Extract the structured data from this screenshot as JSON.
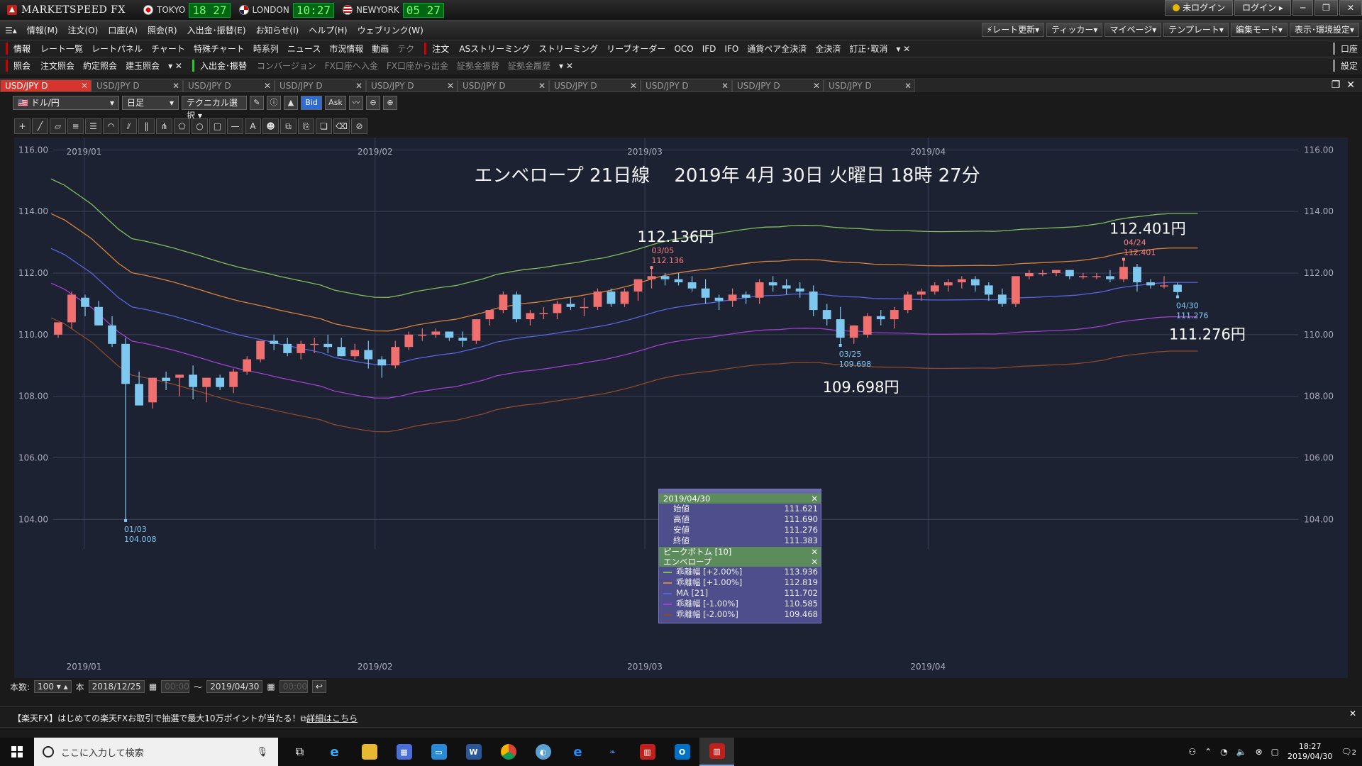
{
  "app": {
    "logo_text": "MARKETSPEED FX",
    "clocks": [
      {
        "city": "TOKYO",
        "time": "18 27"
      },
      {
        "city": "LONDON",
        "time": "10:27"
      },
      {
        "city": "NEWYORK",
        "time": "05 27"
      }
    ],
    "not_logged_in": "未ログイン",
    "login": "ログイン"
  },
  "menu": {
    "items": [
      "情報(M)",
      "注文(O)",
      "口座(A)",
      "照会(R)",
      "入出金･振替(E)",
      "お知らせ(I)",
      "ヘルプ(H)",
      "ウェブリンク(W)"
    ],
    "right": [
      "レート更新",
      "ティッカー",
      "マイページ",
      "テンプレート",
      "編集モード",
      "表示･環境設定"
    ]
  },
  "toolbar1": {
    "head1": "情報",
    "items1": [
      "レート一覧",
      "レートパネル",
      "チャート",
      "特殊チャート",
      "時系列",
      "ニュース",
      "市況情報",
      "動画",
      "テク"
    ],
    "head2": "注文",
    "items2": [
      "ASストリーミング",
      "ストリーミング",
      "リーブオーダー",
      "OCO",
      "IFD",
      "IFO",
      "通貨ペア全決済",
      "全決済",
      "訂正･取消"
    ],
    "right": "口座"
  },
  "toolbar2": {
    "head1": "照会",
    "items1": [
      "注文照会",
      "約定照会",
      "建玉照会"
    ],
    "head2": "入出金･振替",
    "items2": [
      "コンバージョン",
      "FX口座へ入金",
      "FX口座から出金",
      "証拠金振替",
      "証拠金履歴"
    ],
    "right": "設定"
  },
  "tabs": [
    "USD/JPY D",
    "USD/JPY D",
    "USD/JPY D",
    "USD/JPY D",
    "USD/JPY D",
    "USD/JPY D",
    "USD/JPY D",
    "USD/JPY D",
    "USD/JPY D",
    "USD/JPY D"
  ],
  "chart_controls": {
    "pair": "ドル/円",
    "period": "日足",
    "technical": "テクニカル選択",
    "bid": "Bid",
    "ask": "Ask"
  },
  "chart_data": {
    "type": "candlestick",
    "title": "エンベロープ 21日線　 2019年 4月 30日 火曜日 18時 27分",
    "ylim": [
      103.5,
      116.4
    ],
    "yticks": [
      "116.00",
      "114.00",
      "112.00",
      "110.00",
      "108.00",
      "106.00",
      "104.00"
    ],
    "month_labels": [
      {
        "label": "2019/01",
        "index": 2
      },
      {
        "label": "2019/02",
        "index": 24
      },
      {
        "label": "2019/03",
        "index": 44
      },
      {
        "label": "2019/04",
        "index": 65
      }
    ],
    "candles": [
      [
        110.0,
        110.4,
        109.9,
        110.4
      ],
      [
        110.4,
        111.4,
        110.2,
        111.3
      ],
      [
        111.2,
        111.3,
        110.6,
        110.9
      ],
      [
        110.9,
        111.1,
        110.3,
        110.3
      ],
      [
        110.3,
        110.6,
        109.6,
        109.7
      ],
      [
        109.7,
        109.9,
        104.008,
        108.4
      ],
      [
        108.4,
        108.8,
        107.8,
        107.7
      ],
      [
        107.8,
        108.6,
        107.6,
        108.6
      ],
      [
        108.6,
        108.8,
        108.2,
        108.5
      ],
      [
        108.6,
        108.7,
        108.0,
        108.7
      ],
      [
        108.7,
        109.0,
        107.9,
        108.3
      ],
      [
        108.3,
        108.6,
        107.8,
        108.6
      ],
      [
        108.6,
        108.7,
        108.2,
        108.3
      ],
      [
        108.3,
        108.9,
        108.1,
        108.8
      ],
      [
        108.8,
        109.3,
        108.7,
        109.2
      ],
      [
        109.2,
        109.8,
        109.1,
        109.8
      ],
      [
        109.8,
        110.0,
        109.5,
        109.7
      ],
      [
        109.7,
        109.9,
        109.3,
        109.4
      ],
      [
        109.4,
        109.8,
        109.2,
        109.7
      ],
      [
        109.7,
        109.9,
        109.4,
        109.7
      ],
      [
        109.7,
        110.0,
        109.4,
        109.6
      ],
      [
        109.6,
        109.9,
        109.3,
        109.3
      ],
      [
        109.3,
        109.7,
        109.2,
        109.5
      ],
      [
        109.5,
        109.8,
        108.9,
        109.2
      ],
      [
        109.2,
        109.3,
        108.6,
        109.0
      ],
      [
        109.0,
        109.8,
        108.9,
        109.6
      ],
      [
        109.6,
        110.1,
        109.5,
        110.0
      ],
      [
        110.0,
        110.2,
        109.8,
        110.0
      ],
      [
        110.0,
        110.2,
        109.9,
        110.1
      ],
      [
        110.1,
        110.1,
        109.8,
        109.9
      ],
      [
        109.9,
        110.1,
        109.6,
        109.8
      ],
      [
        109.8,
        110.5,
        109.7,
        110.5
      ],
      [
        110.5,
        110.8,
        110.3,
        110.8
      ],
      [
        110.8,
        111.4,
        110.7,
        111.3
      ],
      [
        111.3,
        111.4,
        110.4,
        110.5
      ],
      [
        110.5,
        110.8,
        110.3,
        110.7
      ],
      [
        110.7,
        110.9,
        110.5,
        110.7
      ],
      [
        110.7,
        111.1,
        110.5,
        111.0
      ],
      [
        111.0,
        111.2,
        110.8,
        110.9
      ],
      [
        110.9,
        111.2,
        110.6,
        110.9
      ],
      [
        110.9,
        111.5,
        110.8,
        111.4
      ],
      [
        111.4,
        111.5,
        110.9,
        111.0
      ],
      [
        111.0,
        111.5,
        110.9,
        111.4
      ],
      [
        111.4,
        111.8,
        111.1,
        111.8
      ],
      [
        111.8,
        112.136,
        111.5,
        111.9
      ],
      [
        111.9,
        112.0,
        111.6,
        111.8
      ],
      [
        111.8,
        112.0,
        111.6,
        111.7
      ],
      [
        111.7,
        111.9,
        111.4,
        111.5
      ],
      [
        111.5,
        111.8,
        111.0,
        111.2
      ],
      [
        111.2,
        111.3,
        110.8,
        111.1
      ],
      [
        111.1,
        111.5,
        110.9,
        111.3
      ],
      [
        111.3,
        111.4,
        111.0,
        111.2
      ],
      [
        111.2,
        111.8,
        111.0,
        111.7
      ],
      [
        111.7,
        111.9,
        111.4,
        111.6
      ],
      [
        111.6,
        111.8,
        111.3,
        111.5
      ],
      [
        111.5,
        111.7,
        111.2,
        111.4
      ],
      [
        111.4,
        111.6,
        110.6,
        110.8
      ],
      [
        110.8,
        111.0,
        110.3,
        110.5
      ],
      [
        110.5,
        110.9,
        109.698,
        109.9
      ],
      [
        109.9,
        110.3,
        109.7,
        110.3
      ],
      [
        110.0,
        110.7,
        109.9,
        110.6
      ],
      [
        110.6,
        110.8,
        110.3,
        110.5
      ],
      [
        110.5,
        110.9,
        110.2,
        110.8
      ],
      [
        110.8,
        111.4,
        110.7,
        111.3
      ],
      [
        111.3,
        111.5,
        111.1,
        111.4
      ],
      [
        111.4,
        111.7,
        111.3,
        111.6
      ],
      [
        111.6,
        111.8,
        111.4,
        111.7
      ],
      [
        111.7,
        111.9,
        111.5,
        111.8
      ],
      [
        111.8,
        111.9,
        111.4,
        111.6
      ],
      [
        111.6,
        111.7,
        111.1,
        111.3
      ],
      [
        111.3,
        111.5,
        110.9,
        111.0
      ],
      [
        111.0,
        111.9,
        110.9,
        111.9
      ],
      [
        111.9,
        112.1,
        111.8,
        112.0
      ],
      [
        112.0,
        112.1,
        111.9,
        112.0
      ],
      [
        112.0,
        112.1,
        111.9,
        112.1
      ],
      [
        112.1,
        112.1,
        111.8,
        111.9
      ],
      [
        111.9,
        112.0,
        111.8,
        111.9
      ],
      [
        111.9,
        112.0,
        111.8,
        111.9
      ],
      [
        111.9,
        112.1,
        111.7,
        111.8
      ],
      [
        111.8,
        112.401,
        111.7,
        112.2
      ],
      [
        112.2,
        112.3,
        111.4,
        111.7
      ],
      [
        111.7,
        111.8,
        111.5,
        111.6
      ],
      [
        111.6,
        111.9,
        111.5,
        111.6
      ],
      [
        111.621,
        111.69,
        111.276,
        111.383
      ]
    ],
    "envelope": {
      "ma_start": [
        112.8,
        112.6,
        112.3,
        112.0,
        111.6,
        111.2,
        110.9
      ],
      "lines": [
        {
          "name": "乖離幅 [+2.00%]",
          "color": "#7fbf5a",
          "offset": 0.02
        },
        {
          "name": "乖離幅 [+1.00%]",
          "color": "#d9833a",
          "offset": 0.01
        },
        {
          "name": "MA [21]",
          "color": "#5566dd",
          "offset": 0
        },
        {
          "name": "乖離幅 [-1.00%]",
          "color": "#a040d0",
          "offset": -0.01
        },
        {
          "name": "乖離幅 [-2.00%]",
          "color": "#8a4a2a",
          "offset": -0.02
        }
      ]
    },
    "annotations": [
      {
        "index": 44,
        "date": "03/05",
        "value": "112.136",
        "big": "112.136円",
        "pos": "high",
        "color": "#ff8080"
      },
      {
        "index": 79,
        "date": "04/24",
        "value": "112.401",
        "big": "112.401円",
        "pos": "high",
        "color": "#ff8080"
      },
      {
        "index": 58,
        "date": "03/25",
        "value": "109.698",
        "big": "109.698円",
        "pos": "low",
        "color": "#7ec8f0"
      },
      {
        "index": 83,
        "date": "04/30",
        "value": "111.276",
        "big": "111.276円",
        "pos": "low",
        "color": "#7ec8f0"
      },
      {
        "index": 5,
        "date": "01/03",
        "value": "104.008",
        "big": "",
        "pos": "low",
        "color": "#7ec8f0"
      }
    ]
  },
  "data_panel": {
    "date": "2019/04/30",
    "ohlc": [
      {
        "label": "始値",
        "value": "111.621"
      },
      {
        "label": "高値",
        "value": "111.690"
      },
      {
        "label": "安値",
        "value": "111.276"
      },
      {
        "label": "終値",
        "value": "111.383"
      }
    ],
    "peak_bottom": "ピークボトム [10]",
    "envelope": "エンベロープ",
    "lines": [
      {
        "label": "乖離幅 [+2.00%]",
        "value": "113.936",
        "color": "#7fbf5a"
      },
      {
        "label": "乖離幅 [+1.00%]",
        "value": "112.819",
        "color": "#d9833a"
      },
      {
        "label": "MA [21]",
        "value": "111.702",
        "color": "#5566dd"
      },
      {
        "label": "乖離幅 [-1.00%]",
        "value": "110.585",
        "color": "#a040d0"
      },
      {
        "label": "乖離幅 [-2.00%]",
        "value": "109.468",
        "color": "#8a4a2a"
      }
    ]
  },
  "bottombar": {
    "count_label": "本数:",
    "count": "100",
    "unit": "本",
    "from": "2018/12/25",
    "from_time": "00:00",
    "tilde": "～",
    "to": "2019/04/30",
    "to_time": "00:00"
  },
  "news": {
    "text": "【楽天FX】はじめての楽天FXお取引で抽選で最大10万ポイントが当たる！",
    "link": "詳細はこちら"
  },
  "taskbar": {
    "search_placeholder": "ここに入力して検索",
    "time": "18:27",
    "date": "2019/04/30",
    "notif": "2"
  }
}
